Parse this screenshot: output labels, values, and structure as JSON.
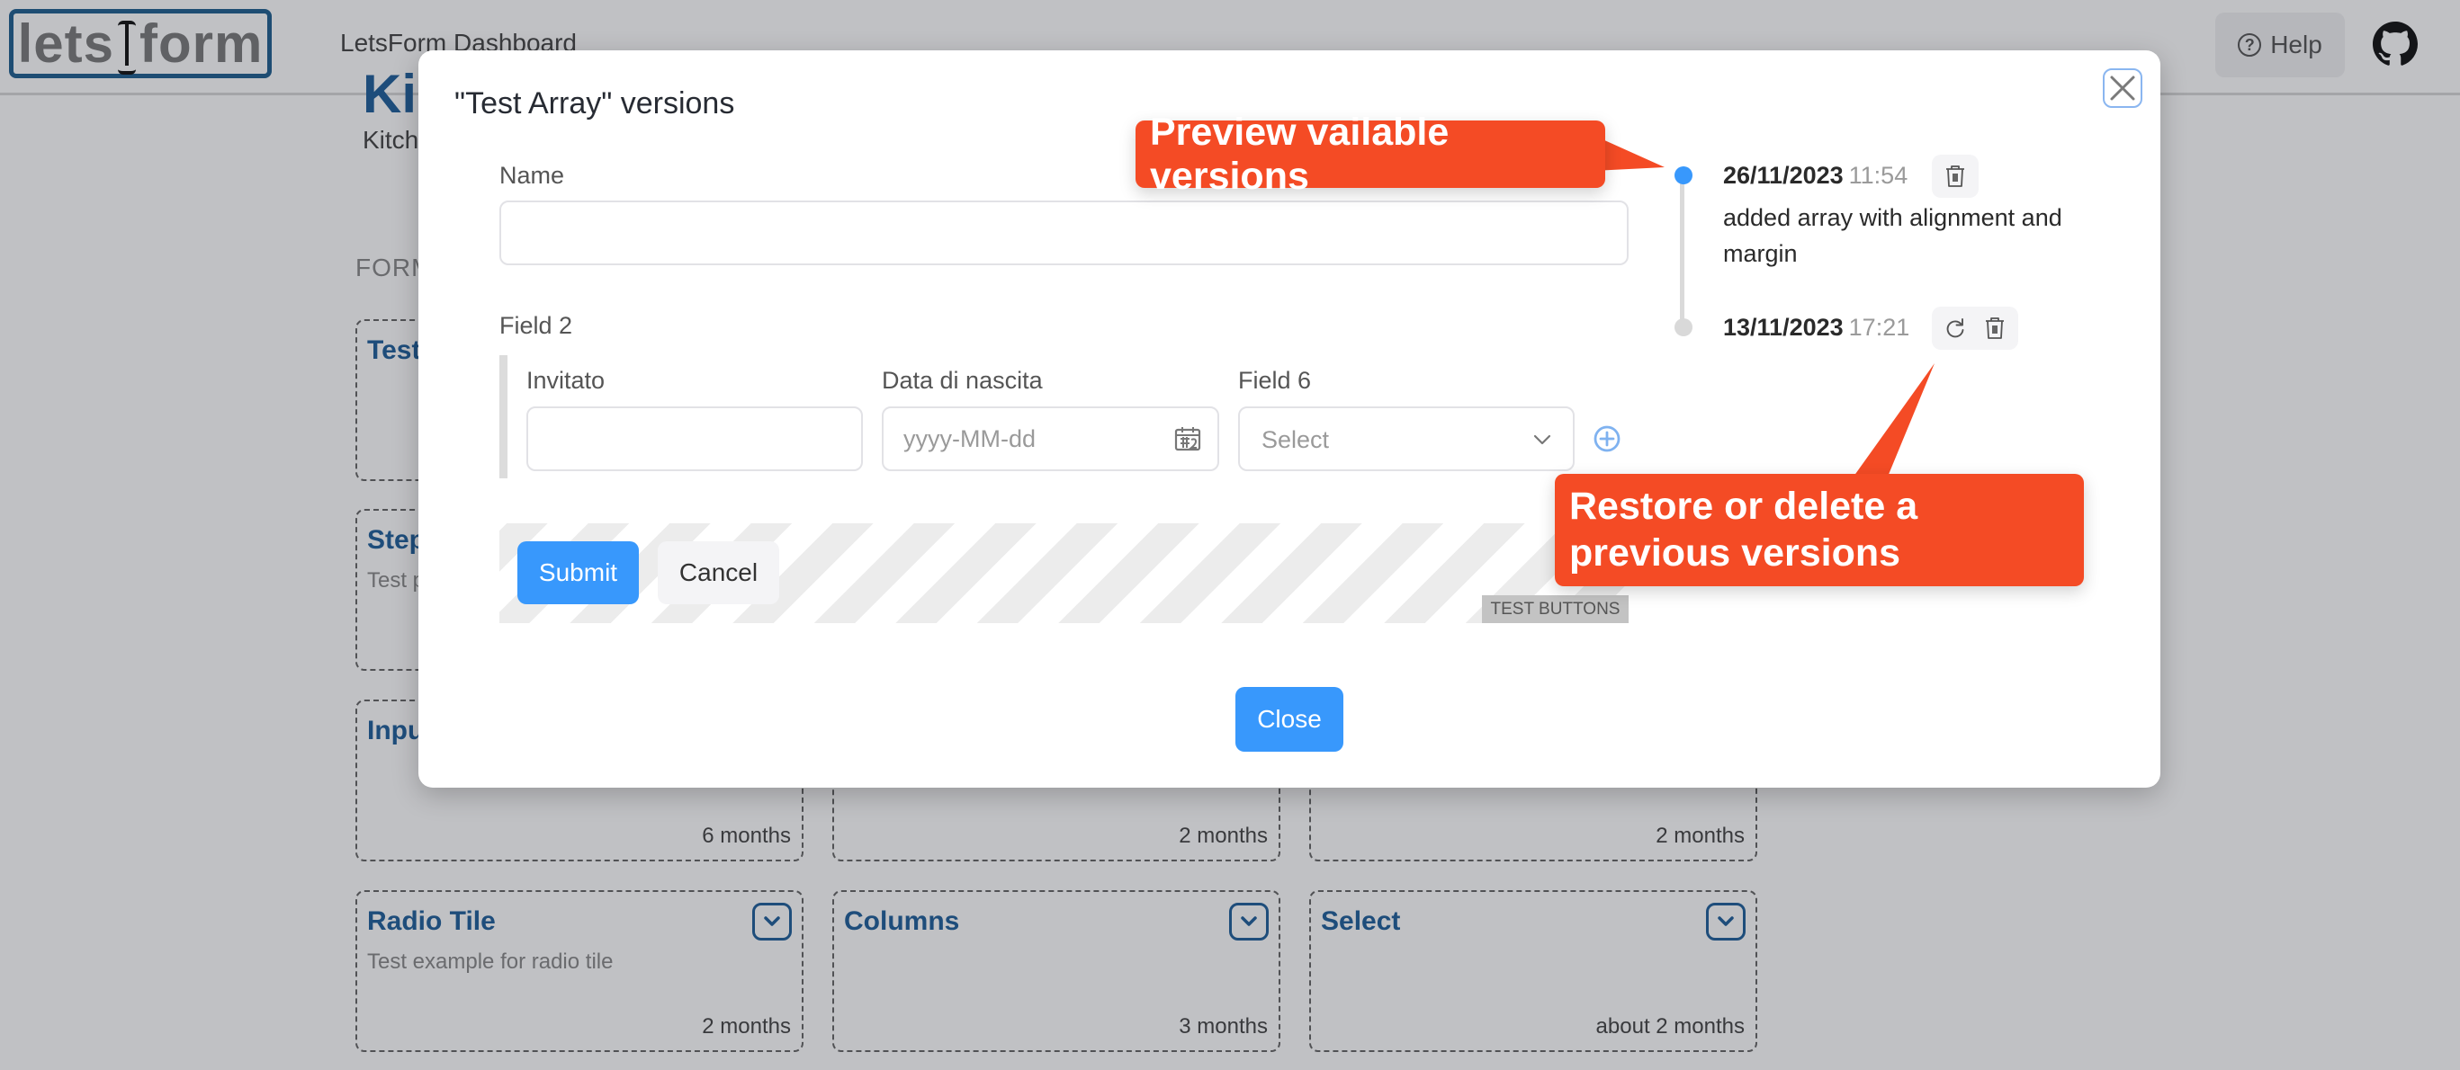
{
  "header": {
    "logo_left": "lets",
    "logo_right": "form",
    "app_title": "LetsForm Dashboard",
    "help_label": "Help",
    "help_icon": "question-circle-icon",
    "github_icon": "github-icon"
  },
  "page": {
    "hero_title": "Ki",
    "hero_subtitle": "Kitch",
    "section_label": "FORM",
    "cards": [
      {
        "title": "Test",
        "description": "",
        "date": ""
      },
      {
        "title": "Step",
        "description": "Test p",
        "date": ""
      },
      {
        "title": "Inpu",
        "description": "",
        "date": "6 months"
      },
      {
        "title": "",
        "description": "",
        "date": "2 months"
      },
      {
        "title": "",
        "description": "",
        "date": "2 months"
      },
      {
        "title": "Radio Tile",
        "description": "Test example for radio tile",
        "date": "2 months"
      },
      {
        "title": "Columns",
        "description": "",
        "date": "3 months"
      },
      {
        "title": "Select",
        "description": "",
        "date": "about 2 months"
      }
    ]
  },
  "modal": {
    "title": "\"Test Array\" versions",
    "close_icon": "close-icon",
    "form": {
      "name_label": "Name",
      "name_value": "",
      "field2_label": "Field 2",
      "invitato_label": "Invitato",
      "invitato_value": "",
      "date_label": "Data di nascita",
      "date_placeholder": "yyyy-MM-dd",
      "field6_label": "Field 6",
      "field6_placeholder": "Select",
      "submit_label": "Submit",
      "cancel_label": "Cancel",
      "test_buttons_badge": "TEST BUTTONS"
    },
    "close_button_label": "Close",
    "versions": [
      {
        "date": "26/11/2023",
        "time": "11:54",
        "description": "added array with alignment and margin",
        "current": true,
        "actions": [
          "delete"
        ]
      },
      {
        "date": "13/11/2023",
        "time": "17:21",
        "description": "",
        "current": false,
        "actions": [
          "restore",
          "delete"
        ]
      }
    ]
  },
  "callouts": {
    "preview": "Preview vailable versions",
    "restore": "Restore or delete a previous versions",
    "color": "#f44b25"
  },
  "colors": {
    "primary": "#3898fc",
    "brand_blue": "#1f5f9a",
    "timeline_active": "#3898fc",
    "timeline_inactive": "#d9d9d9"
  }
}
